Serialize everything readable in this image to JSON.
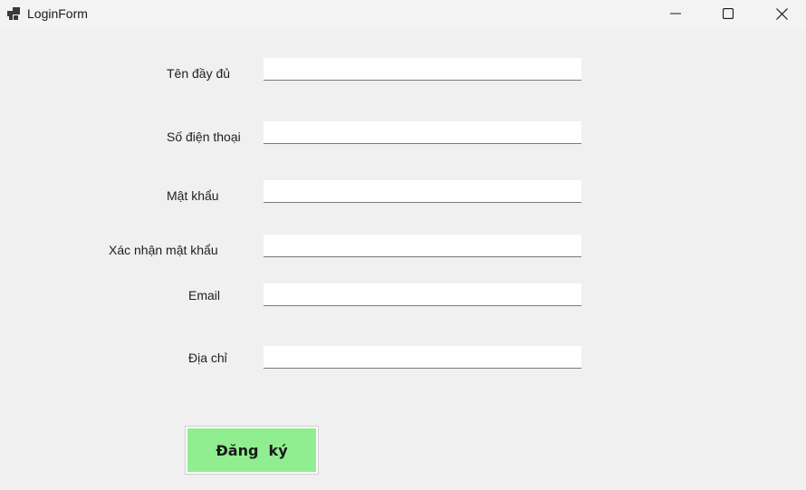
{
  "window": {
    "title": "LoginForm",
    "app_icon": "winforms-app-icon",
    "controls": {
      "minimize_icon": "minimize-icon",
      "maximize_icon": "maximize-icon",
      "close_icon": "close-icon"
    }
  },
  "form": {
    "fields": {
      "full_name": {
        "label": "Tên đầy đủ",
        "value": "",
        "placeholder": ""
      },
      "phone": {
        "label": "Số điện thoại",
        "value": "",
        "placeholder": ""
      },
      "password": {
        "label": "Mật khẩu",
        "value": "",
        "placeholder": ""
      },
      "confirm_password": {
        "label": "Xác nhận mật khẩu",
        "value": "",
        "placeholder": ""
      },
      "email": {
        "label": "Email",
        "value": "",
        "placeholder": ""
      },
      "address": {
        "label": "Địa chỉ",
        "value": "",
        "placeholder": ""
      }
    },
    "submit_label": "Đăng  ký"
  },
  "colors": {
    "submit_background": "#90ee90",
    "window_background": "#f0f0f0",
    "titlebar_background": "#f3f3f3"
  }
}
